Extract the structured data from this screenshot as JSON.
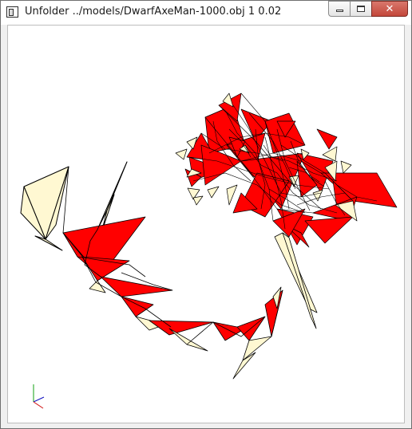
{
  "window": {
    "title": "Unfolder ../models/DwarfAxeMan-1000.obj 1 0.02",
    "buttons": {
      "minimize": "minimize",
      "maximize": "maximize",
      "close": "✕"
    }
  },
  "viewport": {
    "background_color": "#ffffff",
    "face_color_primary": "#ff0000",
    "face_color_secondary": "#fff8d2",
    "edge_color": "#000000",
    "axes_colors": {
      "x": "#d01010",
      "y": "#10a010",
      "z": "#1010c0"
    }
  }
}
